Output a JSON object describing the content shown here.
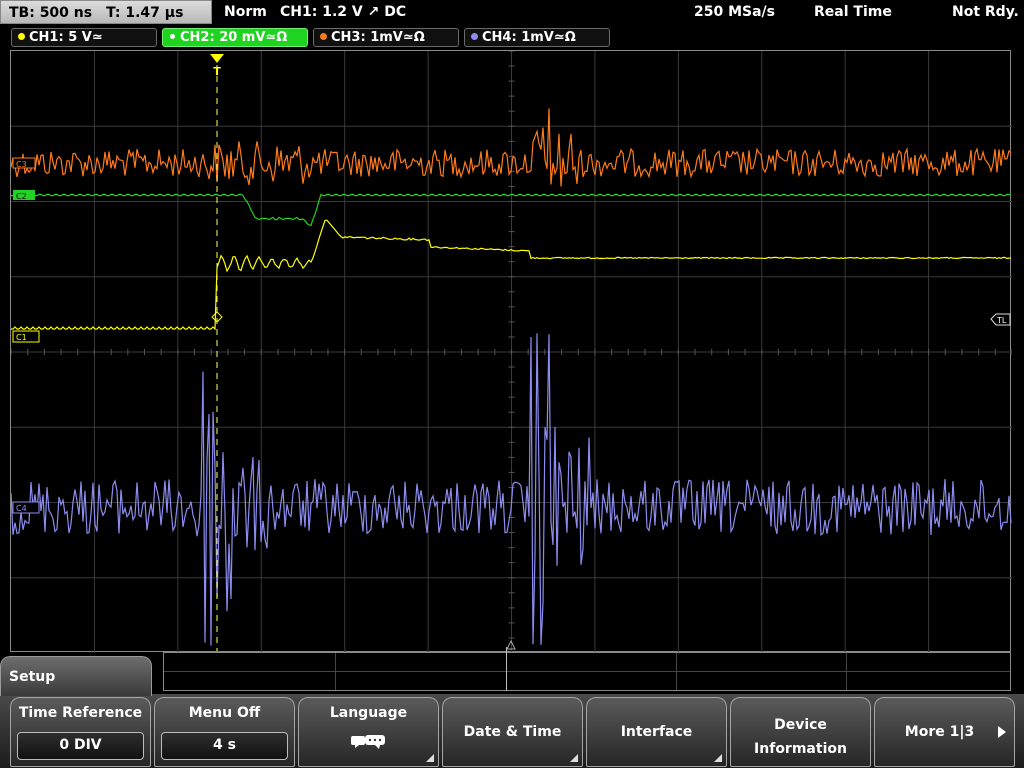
{
  "topbar": {
    "timebase": "TB: 500 ns",
    "trigger_time": "T: 1.47 µs",
    "mode": "Norm",
    "trigger": "CH1: 1.2 V ↗ DC",
    "sample_rate": "250 MSa/s",
    "acquisition": "Real Time",
    "state": "Not Rdy."
  },
  "channels": [
    {
      "label": "CH1: 5 V≃",
      "color": "#ffff00",
      "active": false
    },
    {
      "label": "CH2: 20 mV≃Ω",
      "color": "#21d321",
      "active": true
    },
    {
      "label": "CH3: 1mV≃Ω",
      "color": "#ff7a1a",
      "active": false
    },
    {
      "label": "CH4: 1mV≃Ω",
      "color": "#8c8cf0",
      "active": false
    }
  ],
  "markers": {
    "c3": "C3",
    "c2": "C2",
    "c1": "C1",
    "c4": "C4",
    "trigger_level": "TL",
    "trigger_marker": "T"
  },
  "menu": {
    "title": "Setup",
    "keys": [
      {
        "label": "Time Reference",
        "value": "0 DIV"
      },
      {
        "label": "Menu Off",
        "value": "4 s"
      },
      {
        "label": "Language",
        "icon": "speech-bubbles-icon"
      },
      {
        "label": "Date & Time"
      },
      {
        "label": "Interface"
      },
      {
        "label_line1": "Device",
        "label_line2": "Information"
      },
      {
        "label": "More 1|3"
      }
    ]
  }
}
